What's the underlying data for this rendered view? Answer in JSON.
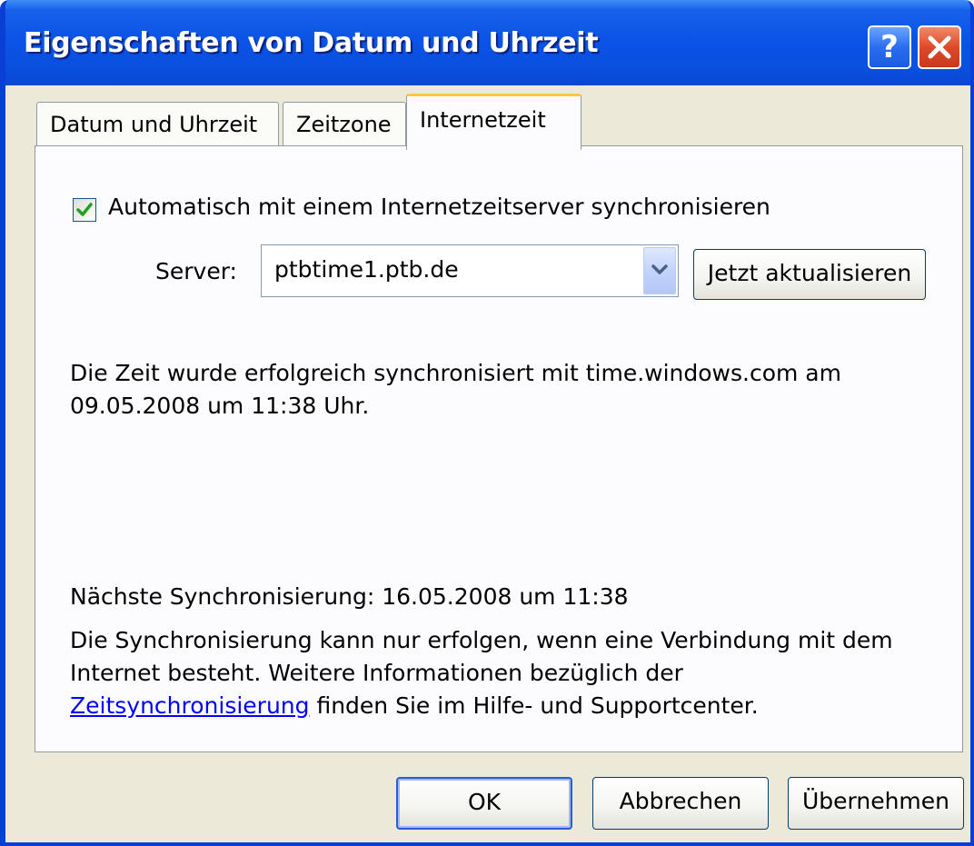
{
  "window": {
    "title": "Eigenschaften von Datum und Uhrzeit",
    "help_label": "?",
    "title_bar_color": "#0a4fe0",
    "body_color": "#ece9d8"
  },
  "tabs": [
    {
      "label": "Datum und Uhrzeit",
      "active": false
    },
    {
      "label": "Zeitzone",
      "active": false
    },
    {
      "label": "Internetzeit",
      "active": true
    }
  ],
  "internet_time": {
    "auto_sync_checked": true,
    "auto_sync_label": "Automatisch mit einem Internetzeitserver synchronisieren",
    "server_label": "Server:",
    "server_value": "ptbtime1.ptb.de",
    "update_button": "Jetzt aktualisieren",
    "sync_status_line1": "Die Zeit wurde erfolgreich synchronisiert mit time.windows.com am",
    "sync_status_line2": "09.05.2008 um 11:38 Uhr.",
    "next_sync": "Nächste Synchronisierung: 16.05.2008 um 11:38",
    "info_line1": "Die Synchronisierung kann nur erfolgen, wenn eine Verbindung mit dem",
    "info_line2": "Internet besteht. Weitere Informationen bezüglich der",
    "info_link": "Zeitsynchronisierung",
    "info_line3_rest": " finden Sie im Hilfe- und Supportcenter."
  },
  "footer": {
    "ok": "OK",
    "cancel": "Abbrechen",
    "apply": "Übernehmen"
  }
}
